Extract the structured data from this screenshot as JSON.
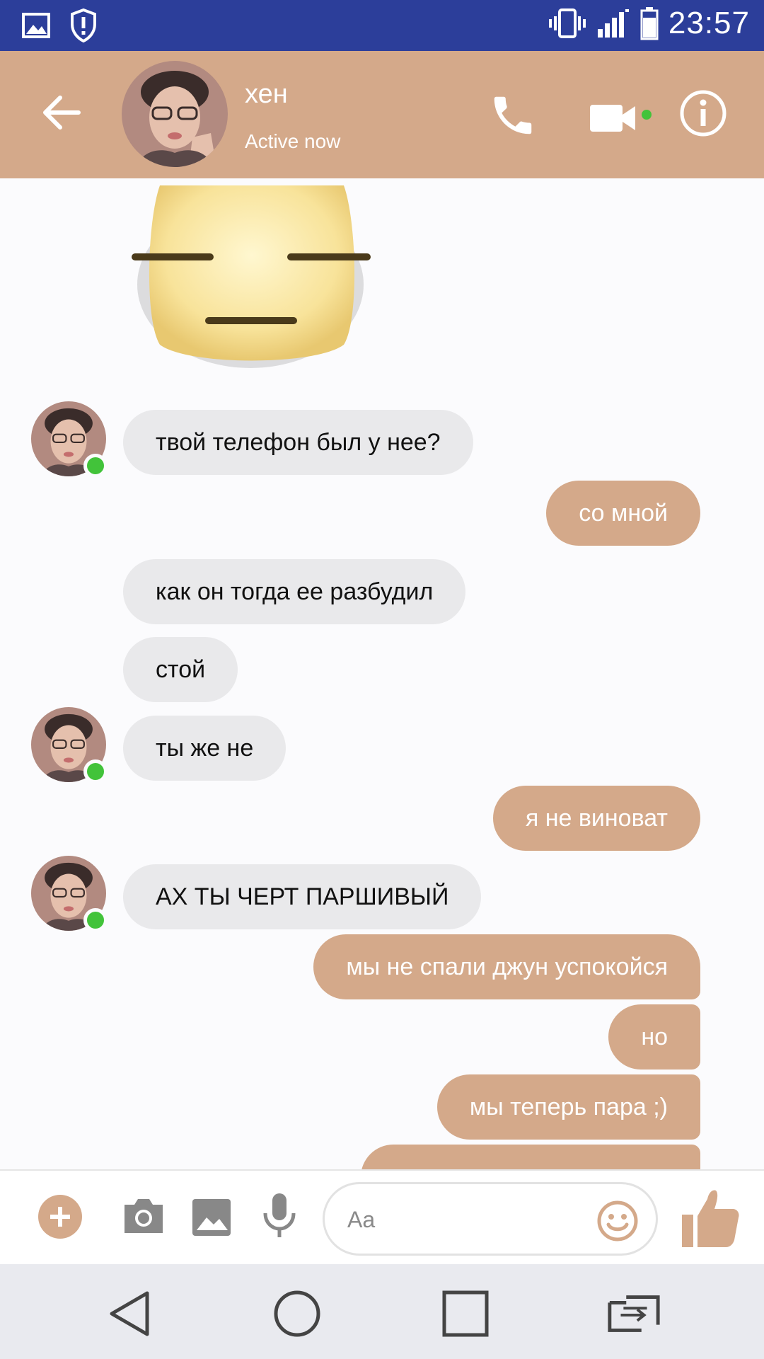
{
  "status_bar": {
    "time": "23:57",
    "icons": [
      "gallery-notification-icon",
      "shield-alert-icon",
      "vibrate-icon",
      "signal-icon",
      "battery-icon"
    ]
  },
  "header": {
    "contact_name": "хен",
    "contact_status": "Active now",
    "icons": [
      "back-arrow-icon",
      "phone-icon",
      "video-camera-icon",
      "info-icon"
    ]
  },
  "messages": [
    {
      "direction": "in",
      "text": "твой телефон был у нее?",
      "avatar": true
    },
    {
      "direction": "out",
      "text": "со мной"
    },
    {
      "direction": "in",
      "text": "как он тогда ее разбудил",
      "avatar": false
    },
    {
      "direction": "in",
      "text": "стой",
      "avatar": false
    },
    {
      "direction": "in",
      "text": "ты же не",
      "avatar": true
    },
    {
      "direction": "out",
      "text": "я не виноват"
    },
    {
      "direction": "in",
      "text": "АХ ТЫ ЧЕРТ ПАРШИВЫЙ",
      "avatar": true
    },
    {
      "direction": "out",
      "text": "мы не спали джун успокойся"
    },
    {
      "direction": "out",
      "text": "но"
    },
    {
      "direction": "out",
      "text": "мы теперь пара ;)"
    }
  ],
  "composer": {
    "placeholder": "Aa",
    "icons": [
      "plus-icon",
      "camera-icon",
      "gallery-icon",
      "microphone-icon",
      "emoji-icon",
      "thumbs-up-icon"
    ]
  },
  "colors": {
    "accent": "#d4a98a",
    "status_bar": "#2c3e9a",
    "incoming_bubble": "#e9e9eb",
    "online": "#42c33a",
    "nav_bar": "#e9eaef"
  }
}
